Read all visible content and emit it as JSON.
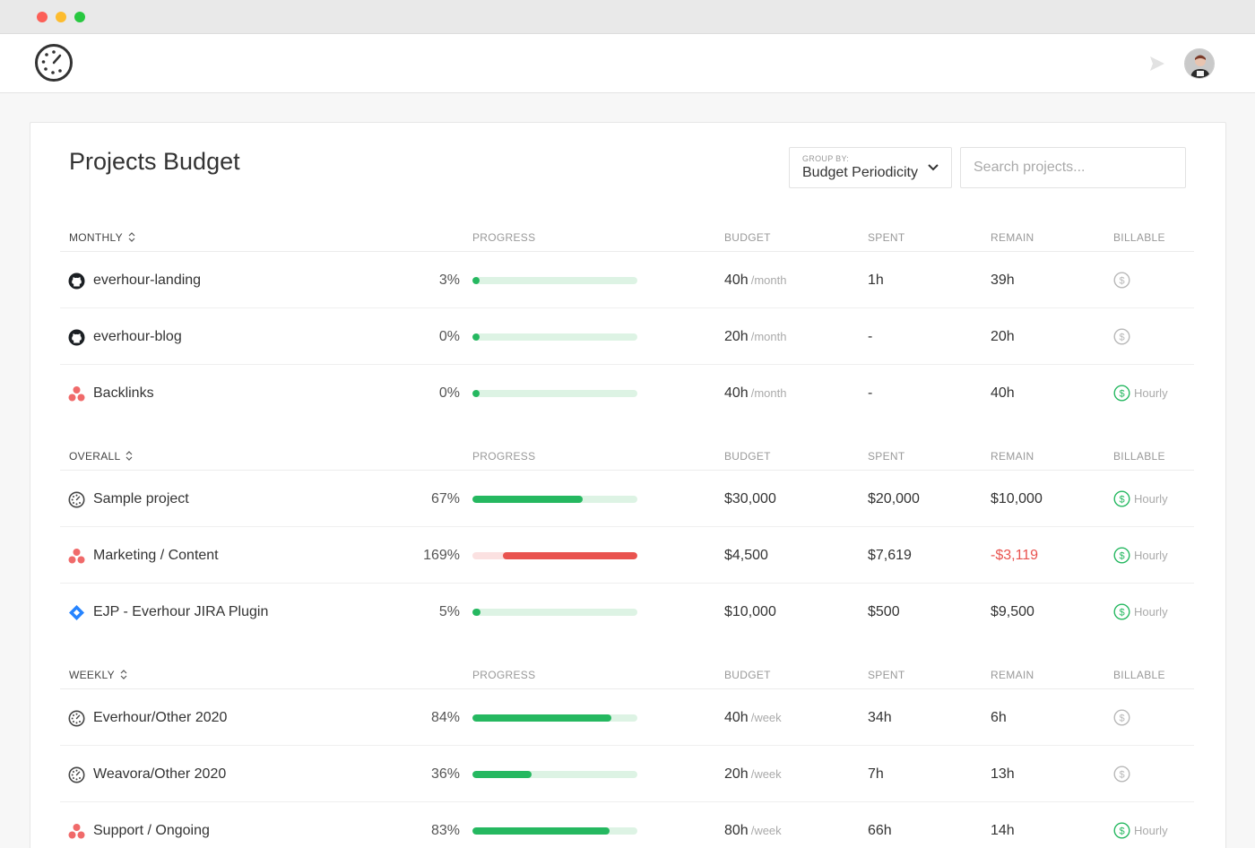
{
  "page": {
    "title": "Projects Budget",
    "group_by_label": "GROUP BY:",
    "group_by_value": "Budget Periodicity",
    "search_placeholder": "Search projects..."
  },
  "columns": {
    "progress": "PROGRESS",
    "budget": "BUDGET",
    "spent": "SPENT",
    "remain": "REMAIN",
    "billable": "BILLABLE"
  },
  "colors": {
    "progress_green": "#25b860",
    "progress_track": "#ddf3e4",
    "over_red": "#e9534f",
    "over_track": "#fbe1e1"
  },
  "sections": [
    {
      "group": "MONTHLY",
      "rows": [
        {
          "icon": "github-icon",
          "name": "everhour-landing",
          "percent": "3%",
          "progress": 3,
          "budget": "40h",
          "period": "/month",
          "spent": "1h",
          "remain": "39h",
          "billable": "dollar-icon",
          "billable_active": false,
          "billable_text": ""
        },
        {
          "icon": "github-icon",
          "name": "everhour-blog",
          "percent": "0%",
          "progress": 0,
          "budget": "20h",
          "period": "/month",
          "spent": "-",
          "remain": "20h",
          "billable": "dollar-icon",
          "billable_active": false,
          "billable_text": ""
        },
        {
          "icon": "asana-icon",
          "name": "Backlinks",
          "percent": "0%",
          "progress": 0,
          "budget": "40h",
          "period": "/month",
          "spent": "-",
          "remain": "40h",
          "billable": "dollar-icon",
          "billable_active": true,
          "billable_text": "Hourly"
        }
      ]
    },
    {
      "group": "OVERALL",
      "rows": [
        {
          "icon": "everhour-icon",
          "name": "Sample project",
          "percent": "67%",
          "progress": 67,
          "budget": "$30,000",
          "period": "",
          "spent": "$20,000",
          "remain": "$10,000",
          "billable": "dollar-icon",
          "billable_active": true,
          "billable_text": "Hourly"
        },
        {
          "icon": "asana-icon",
          "name": "Marketing / Content",
          "percent": "169%",
          "progress": 169,
          "budget": "$4,500",
          "period": "",
          "spent": "$7,619",
          "remain": "-$3,119",
          "billable": "dollar-icon",
          "billable_active": true,
          "billable_text": "Hourly"
        },
        {
          "icon": "jira-icon",
          "name": "EJP - Everhour JIRA Plugin",
          "percent": "5%",
          "progress": 5,
          "budget": "$10,000",
          "period": "",
          "spent": "$500",
          "remain": "$9,500",
          "billable": "dollar-icon",
          "billable_active": true,
          "billable_text": "Hourly"
        }
      ]
    },
    {
      "group": "WEEKLY",
      "rows": [
        {
          "icon": "everhour-icon",
          "name": "Everhour/Other 2020",
          "percent": "84%",
          "progress": 84,
          "budget": "40h",
          "period": "/week",
          "spent": "34h",
          "remain": "6h",
          "billable": "dollar-icon",
          "billable_active": false,
          "billable_text": ""
        },
        {
          "icon": "everhour-icon",
          "name": "Weavora/Other 2020",
          "percent": "36%",
          "progress": 36,
          "budget": "20h",
          "period": "/week",
          "spent": "7h",
          "remain": "13h",
          "billable": "dollar-icon",
          "billable_active": false,
          "billable_text": ""
        },
        {
          "icon": "asana-icon",
          "name": "Support / Ongoing",
          "percent": "83%",
          "progress": 83,
          "budget": "80h",
          "period": "/week",
          "spent": "66h",
          "remain": "14h",
          "billable": "dollar-icon",
          "billable_active": true,
          "billable_text": "Hourly"
        }
      ]
    }
  ]
}
